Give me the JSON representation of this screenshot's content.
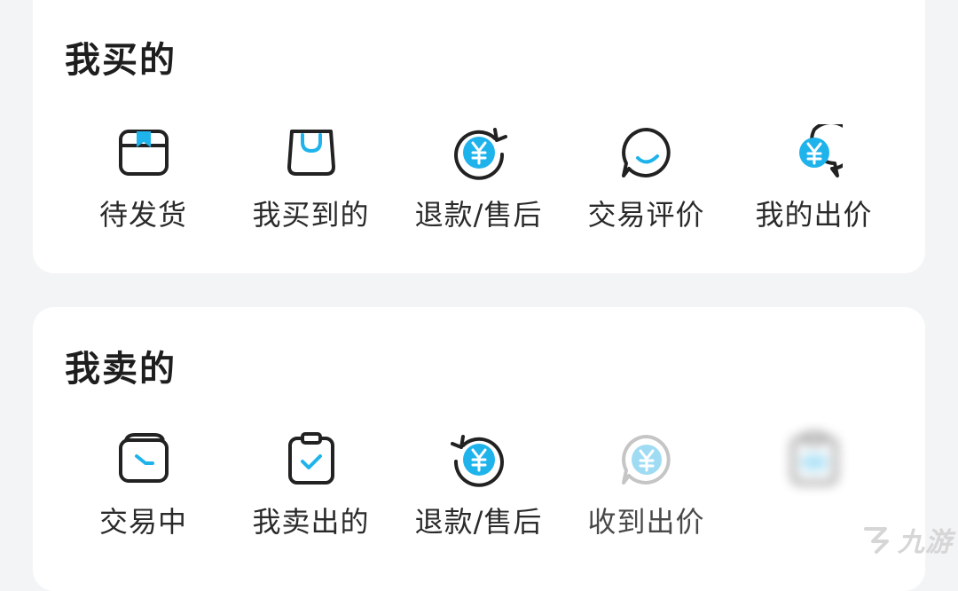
{
  "buy_section": {
    "title": "我买的",
    "items": [
      {
        "label": "待发货",
        "icon": "box-icon"
      },
      {
        "label": "我买到的",
        "icon": "shopping-bag-icon"
      },
      {
        "label": "退款/售后",
        "icon": "yuan-refund-icon"
      },
      {
        "label": "交易评价",
        "icon": "smile-chat-icon"
      },
      {
        "label": "我的出价",
        "icon": "yuan-chat-icon"
      }
    ]
  },
  "sell_section": {
    "title": "我卖的",
    "items": [
      {
        "label": "交易中",
        "icon": "wallet-icon"
      },
      {
        "label": "我卖出的",
        "icon": "checked-clipboard-icon"
      },
      {
        "label": "退款/售后",
        "icon": "yuan-refund-icon"
      },
      {
        "label": "收到出价",
        "icon": "yuan-chat-icon"
      },
      {
        "label": "",
        "icon": "clipboard-icon"
      }
    ]
  },
  "watermark": {
    "text": "九游"
  },
  "colors": {
    "accent": "#1fb3ec",
    "outline": "#222222",
    "card_bg": "#ffffff",
    "page_bg": "#f3f4f6"
  }
}
